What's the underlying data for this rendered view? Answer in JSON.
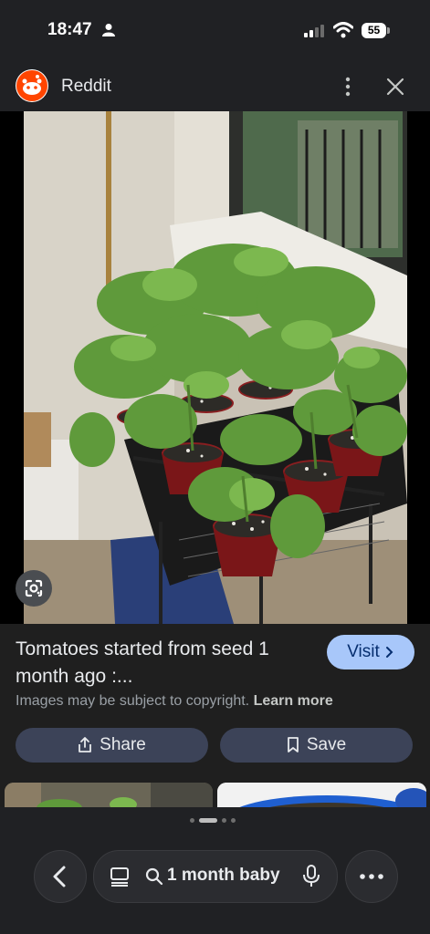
{
  "status_bar": {
    "time": "18:47",
    "battery": "55"
  },
  "header": {
    "site_name": "Reddit",
    "logo_icon": "reddit-logo-icon"
  },
  "image": {
    "subject": "tomato seedlings in red cups on a wire rack by a window"
  },
  "result": {
    "title": "Tomatoes started from seed 1 month ago :...",
    "visit_label": "Visit",
    "copyright_text": "Images may be subject to copyright.",
    "learn_more_label": "Learn more"
  },
  "actions": {
    "share_label": "Share",
    "save_label": "Save"
  },
  "bottom": {
    "search_query": "1 month baby"
  },
  "colors": {
    "visit_bg": "#a8c7fa",
    "pill_bg": "#3c4358",
    "background": "#1f1f1f",
    "reddit_orange": "#ff4500"
  }
}
